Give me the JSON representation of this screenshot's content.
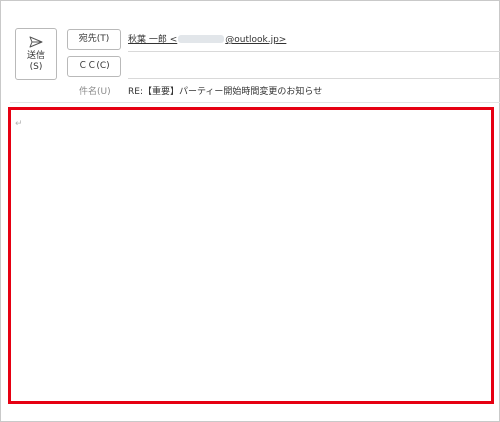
{
  "toolbar": {
    "send_label_line1": "送信",
    "send_label_line2": "(S)",
    "send_icon": "send-icon"
  },
  "header": {
    "to_button_label": "宛先(T)",
    "cc_button_label": "ＣＣ(C)",
    "to_value_prefix": "秋葉 一郎 <",
    "to_value_suffix": "@outlook.jp>",
    "subject_label": "件名(U)",
    "subject_value": "RE:【重要】パーティー開始時間変更のお知らせ"
  },
  "body": {
    "paragraph_mark": "↵"
  },
  "colors": {
    "highlight": "#e60012",
    "border": "#b9b9b9"
  }
}
